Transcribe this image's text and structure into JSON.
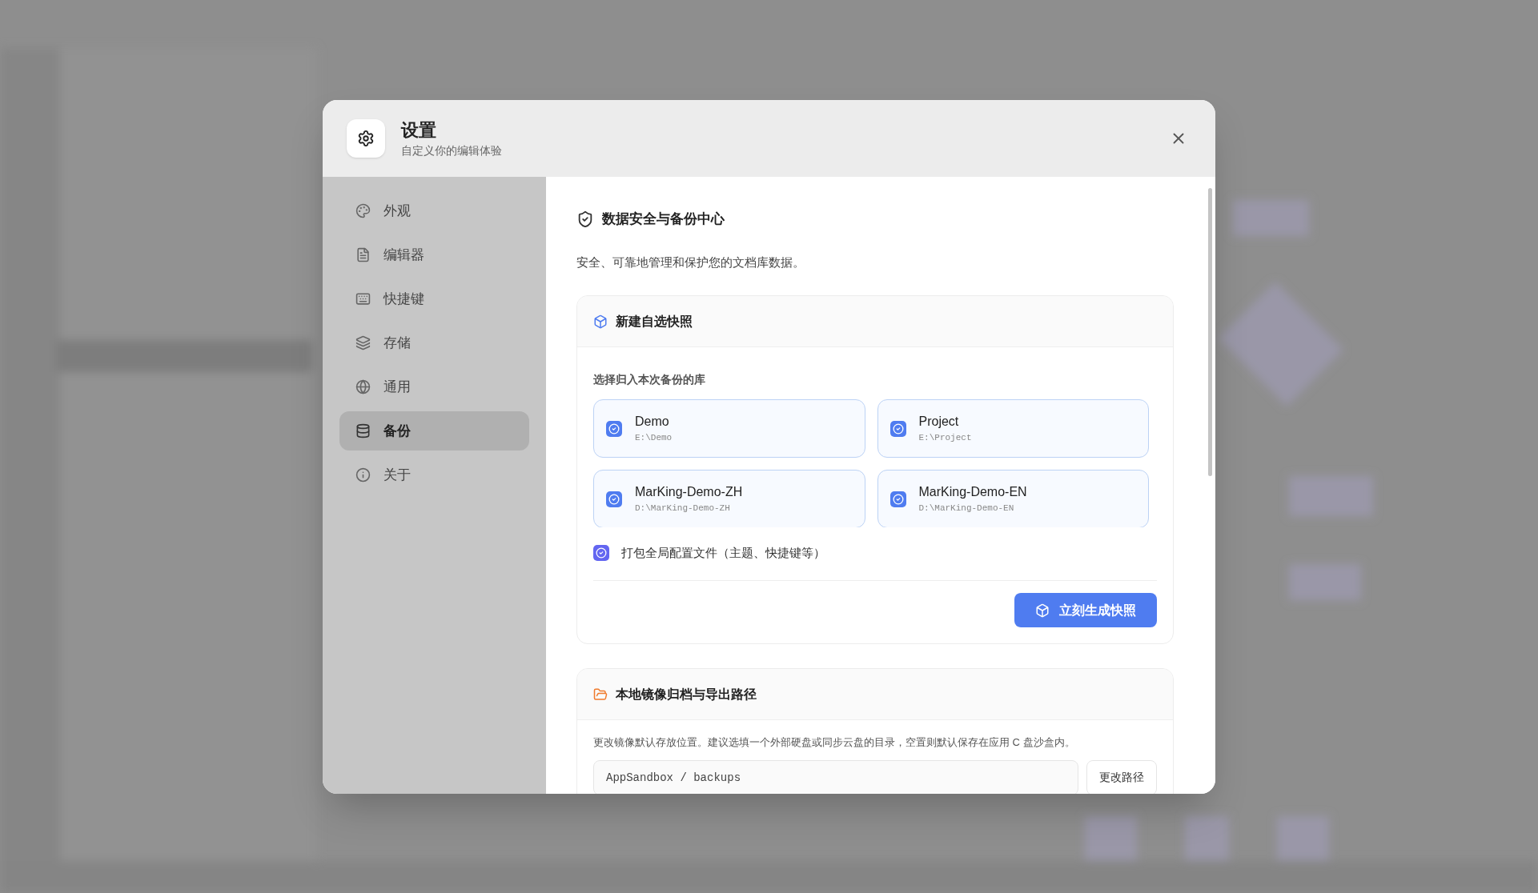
{
  "dialog": {
    "title": "设置",
    "subtitle": "自定义你的编辑体验"
  },
  "nav": [
    {
      "label": "外观",
      "selected": false
    },
    {
      "label": "编辑器",
      "selected": false
    },
    {
      "label": "快捷键",
      "selected": false
    },
    {
      "label": "存储",
      "selected": false
    },
    {
      "label": "通用",
      "selected": false
    },
    {
      "label": "备份",
      "selected": true
    },
    {
      "label": "关于",
      "selected": false
    }
  ],
  "section": {
    "title": "数据安全与备份中心",
    "description": "安全、可靠地管理和保护您的文档库数据。"
  },
  "snapshot": {
    "title": "新建自选快照",
    "libraries_label": "选择归入本次备份的库",
    "libraries": [
      {
        "name": "Demo",
        "path": "E:\\Demo",
        "checked": true
      },
      {
        "name": "Project",
        "path": "E:\\Project",
        "checked": true
      },
      {
        "name": "MarKing-Demo-ZH",
        "path": "D:\\MarKing-Demo-ZH",
        "checked": true
      },
      {
        "name": "MarKing-Demo-EN",
        "path": "D:\\MarKing-Demo-EN",
        "checked": true
      }
    ],
    "include_config": {
      "label": "打包全局配置文件（主题、快捷键等）",
      "checked": true
    },
    "button": "立刻生成快照"
  },
  "archive": {
    "title": "本地镜像归档与导出路径",
    "description": "更改镜像默认存放位置。建议选填一个外部硬盘或同步云盘的目录，空置则默认保存在应用 C 盘沙盒内。",
    "path_value": "AppSandbox / backups",
    "button": "更改路径"
  }
}
